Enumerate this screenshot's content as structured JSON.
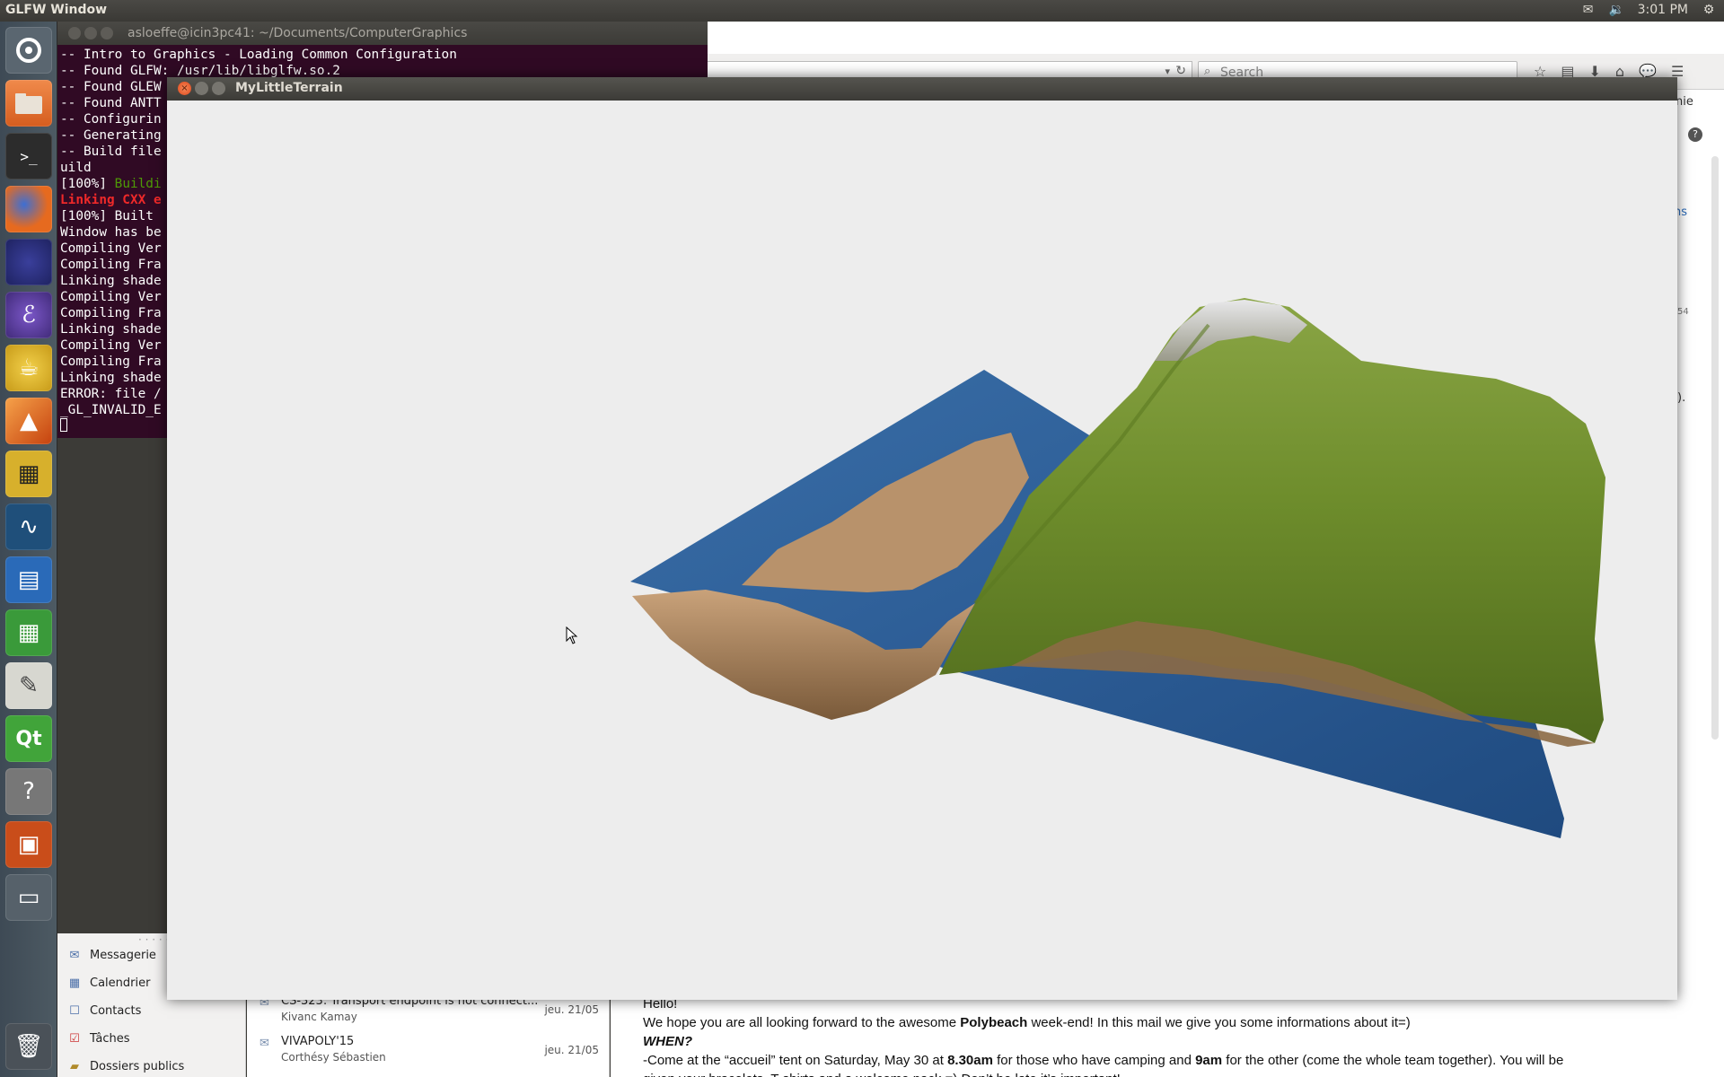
{
  "top_panel": {
    "app_title": "GLFW Window",
    "clock": "3:01 PM",
    "icons": [
      "mail-icon",
      "volume-icon",
      "gear-icon"
    ]
  },
  "launcher": {
    "items": [
      "dash-home",
      "files",
      "terminal",
      "firefox",
      "eclipse",
      "emacs",
      "teapot-app",
      "matlab",
      "video-editor",
      "plotting-app",
      "writer",
      "calc",
      "text-editor",
      "qt-creator",
      "help",
      "impress",
      "workspace-switcher",
      "trash"
    ]
  },
  "terminal": {
    "title": "asloeffe@icin3pc41: ~/Documents/ComputerGraphics",
    "lines": [
      {
        "text": "-- Intro to Graphics - Loading Common Configuration",
        "style": "normal"
      },
      {
        "text": "-- Found GLFW: /usr/lib/libglfw.so.2",
        "style": "normal"
      },
      {
        "text": "-- Found GLEW",
        "style": "normal"
      },
      {
        "text": "-- Found ANTT",
        "style": "normal"
      },
      {
        "text": "-- Configurin",
        "style": "normal"
      },
      {
        "text": "-- Generating",
        "style": "normal"
      },
      {
        "text": "-- Build file",
        "style": "normal"
      },
      {
        "text": "uild",
        "style": "normal"
      },
      {
        "text": "[100%] ",
        "style": "normal",
        "extra": "Buildi",
        "extra_style": "green"
      },
      {
        "text": "Linking CXX e",
        "style": "red"
      },
      {
        "text": "[100%] Built",
        "style": "normal"
      },
      {
        "text": "Window has be",
        "style": "normal"
      },
      {
        "text": "Compiling Ver",
        "style": "normal"
      },
      {
        "text": "Compiling Fra",
        "style": "normal"
      },
      {
        "text": "Linking shade",
        "style": "normal"
      },
      {
        "text": "Compiling Ver",
        "style": "normal"
      },
      {
        "text": "Compiling Fra",
        "style": "normal"
      },
      {
        "text": "Linking shade",
        "style": "normal"
      },
      {
        "text": "Compiling Ver",
        "style": "normal"
      },
      {
        "text": "Compiling Fra",
        "style": "normal"
      },
      {
        "text": "Linking shade",
        "style": "normal"
      },
      {
        "text": "ERROR: file /",
        "style": "normal"
      },
      {
        "text": "_GL_INVALID_E",
        "style": "normal"
      }
    ]
  },
  "browser": {
    "search_placeholder": "Search",
    "side_texts": [
      "nie",
      "?",
      "ns",
      "54",
      ")."
    ]
  },
  "terrain_window": {
    "title": "MyLittleTerrain"
  },
  "mail": {
    "folders": [
      {
        "label": "Messagerie",
        "icon": "mail-icon"
      },
      {
        "label": "Calendrier",
        "icon": "calendar-icon"
      },
      {
        "label": "Contacts",
        "icon": "contacts-icon"
      },
      {
        "label": "Tâches",
        "icon": "tasks-icon"
      },
      {
        "label": "Dossiers publics",
        "icon": "folder-icon"
      }
    ],
    "messages": [
      {
        "subject": "CS-323: Transport endpoint is not connect...",
        "from": "Kivanc Kamay",
        "date": "jeu. 21/05"
      },
      {
        "subject": "VIVAPOLY'15",
        "from": "Corthésy Sébastien",
        "date": "jeu. 21/05"
      }
    ],
    "body": {
      "greeting": "Hello!",
      "line1_a": "We hope you are all looking forward to the awesome ",
      "line1_b": "Polybeach",
      "line1_c": " week-end! In this mail we give you some informations about it=)",
      "when": "WHEN?",
      "line3_a": "-Come at the “accueil” tent on Saturday, May 30 at ",
      "line3_b": "8.30am",
      "line3_c": " for those who have camping and ",
      "line3_d": "9am",
      "line3_e": " for the other (come the whole team together). You will be",
      "line4": "given your bracelets, T-shirts and a welcome pack =) Don’t be late it’s important!"
    }
  }
}
